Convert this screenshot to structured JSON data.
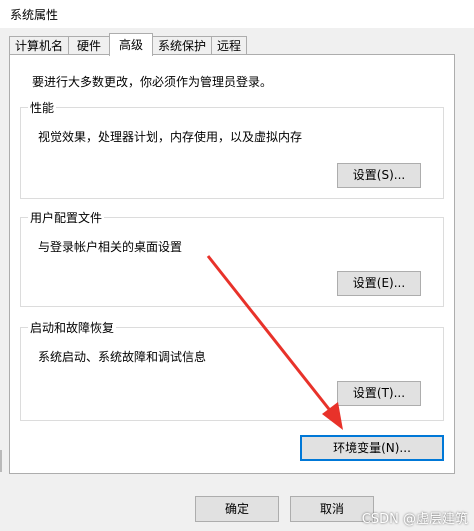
{
  "window": {
    "title": "系统属性"
  },
  "tabs": [
    {
      "label": "计算机名"
    },
    {
      "label": "硬件"
    },
    {
      "label": "高级"
    },
    {
      "label": "系统保护"
    },
    {
      "label": "远程"
    }
  ],
  "advanced": {
    "admin_note": "要进行大多数更改，你必须作为管理员登录。",
    "performance": {
      "title": "性能",
      "desc": "视觉效果，处理器计划，内存使用，以及虚拟内存",
      "button": "设置(S)..."
    },
    "user_profiles": {
      "title": "用户配置文件",
      "desc": "与登录帐户相关的桌面设置",
      "button": "设置(E)..."
    },
    "startup_recovery": {
      "title": "启动和故障恢复",
      "desc": "系统启动、系统故障和调试信息",
      "button": "设置(T)..."
    },
    "env_button": "环境变量(N)..."
  },
  "footer": {
    "ok": "确定",
    "cancel": "取消"
  },
  "watermark": "CSDN @虚层建筑",
  "colors": {
    "arrow": "#e8322a",
    "focus": "#0078d7"
  }
}
